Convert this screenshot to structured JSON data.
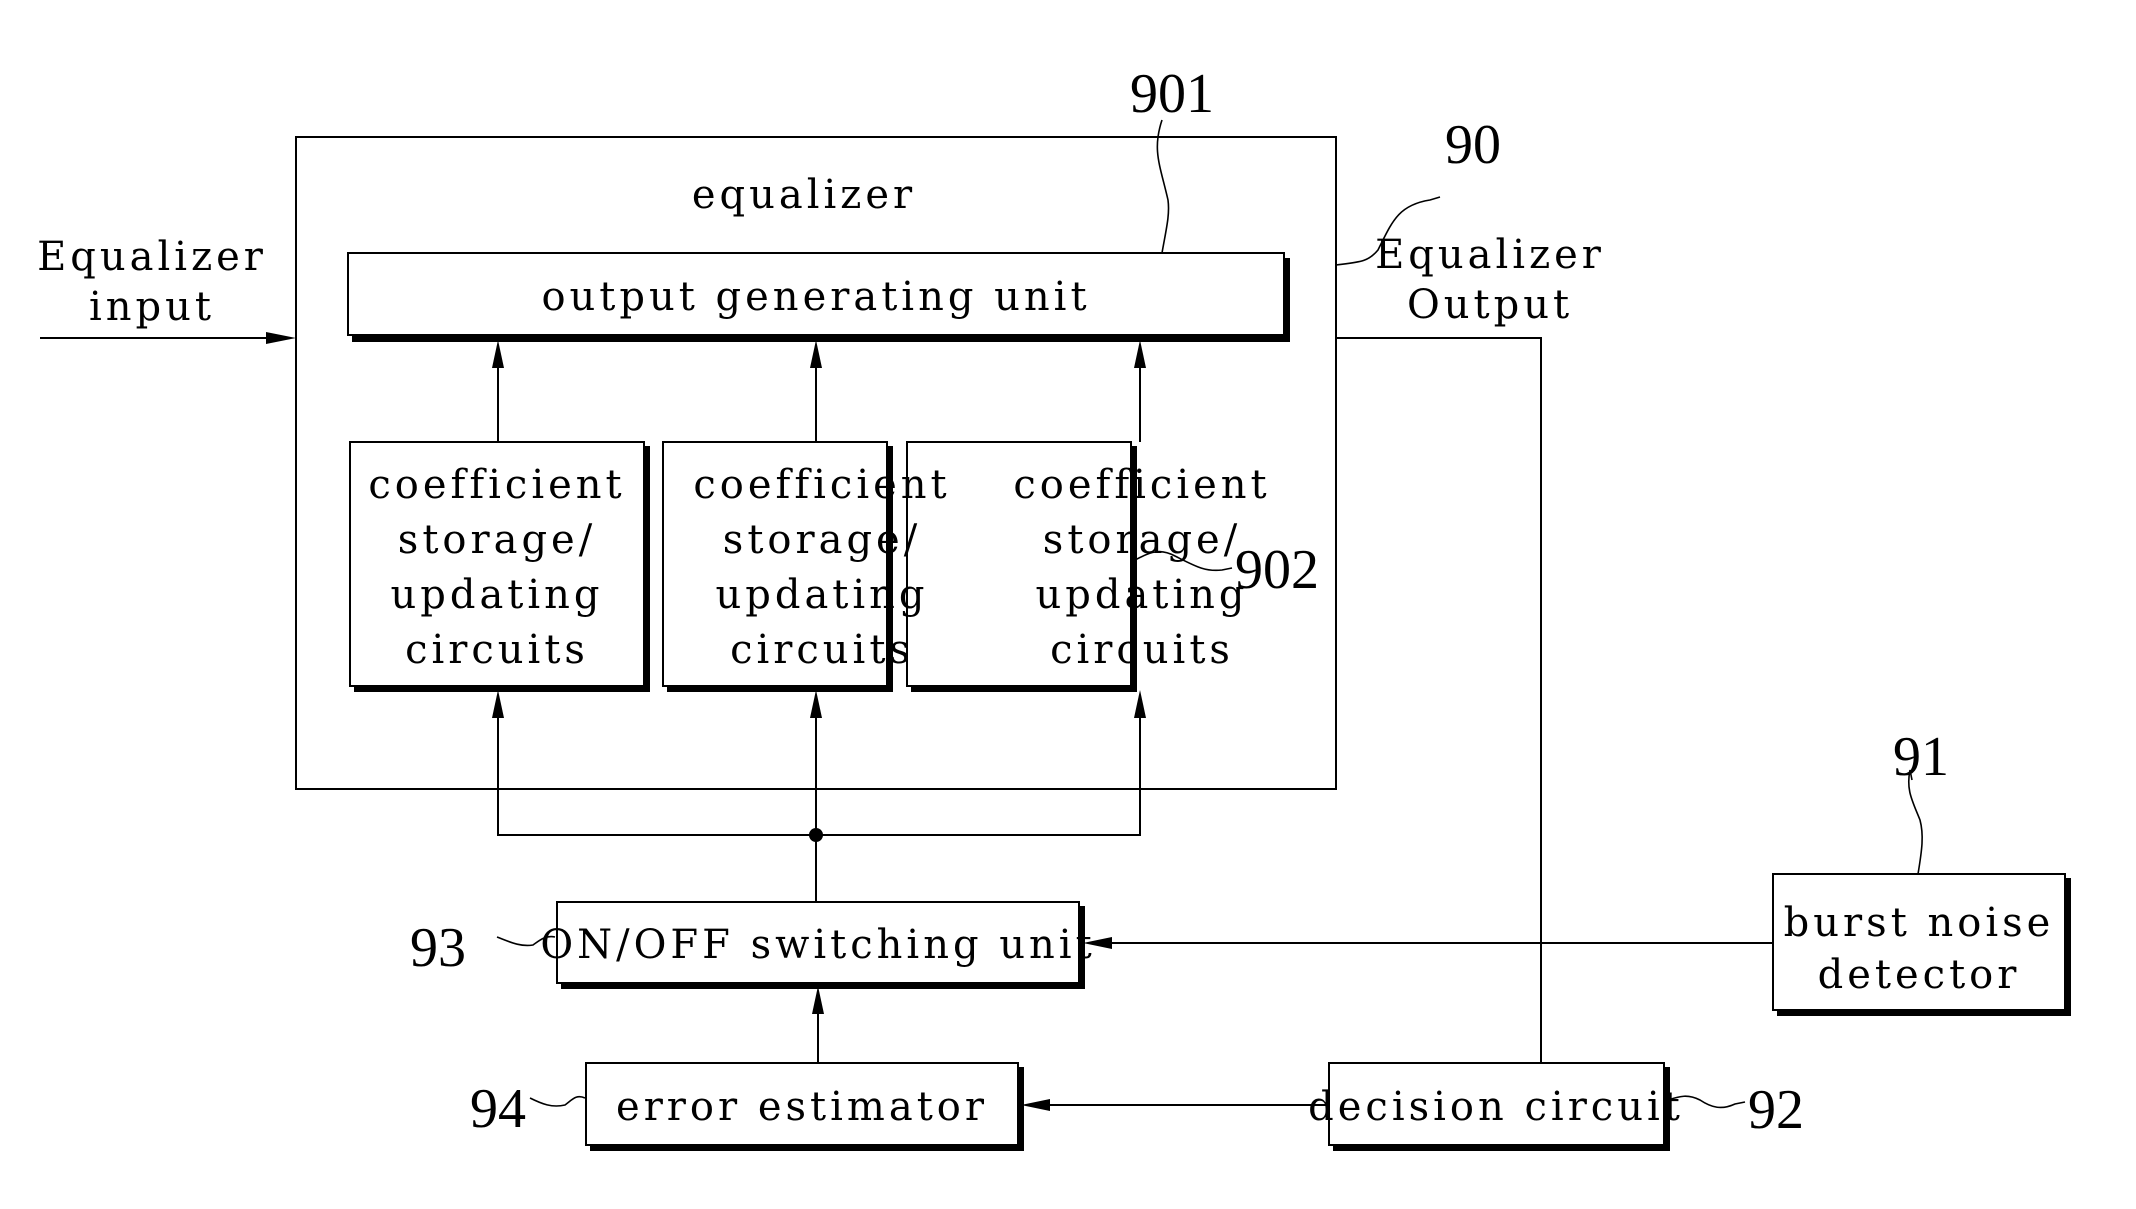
{
  "diagram": {
    "equalizer": {
      "title": "equalizer",
      "ref": "90"
    },
    "input_label": [
      "Equalizer",
      "input"
    ],
    "output_label": [
      "Equalizer",
      "Output"
    ],
    "output_unit": {
      "label": "output generating unit",
      "ref": "901"
    },
    "coef_circuits": {
      "ref": "902",
      "boxes": [
        {
          "lines": [
            "coefficient",
            "storage/",
            "updating",
            "circuits"
          ]
        },
        {
          "lines": [
            "coefficient",
            "storage/",
            "updating",
            "circuits"
          ]
        },
        {
          "lines": [
            "coefficient",
            "storage/",
            "updating",
            "circuits"
          ]
        }
      ]
    },
    "switch_unit": {
      "label": "ON/OFF switching unit",
      "ref": "93"
    },
    "error_estimator": {
      "label": "error estimator",
      "ref": "94"
    },
    "decision_circuit": {
      "label": "decision circuit",
      "ref": "92"
    },
    "burst_detector": {
      "lines": [
        "burst noise",
        "detector"
      ],
      "ref": "91"
    }
  }
}
